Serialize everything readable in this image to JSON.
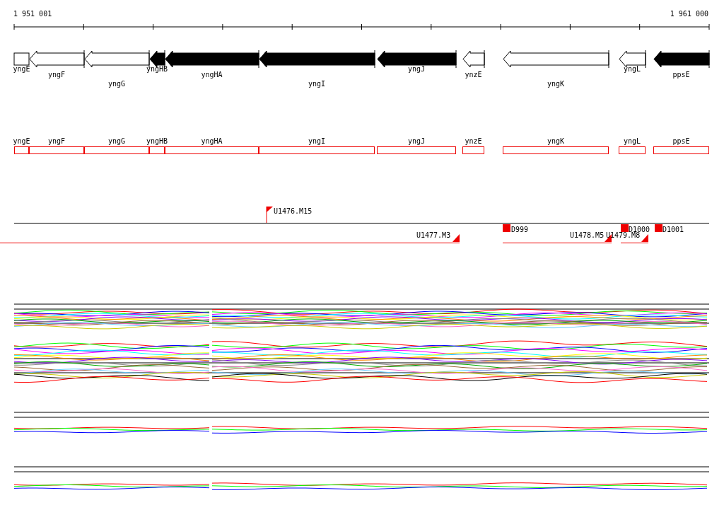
{
  "ruler": {
    "start_label": "1 951 001",
    "end_label": "1 961 000"
  },
  "genes": [
    {
      "name": "yngE",
      "kind": "box",
      "filled": false
    },
    {
      "name": "yngF",
      "kind": "arrow",
      "filled": false
    },
    {
      "name": "yngG",
      "kind": "arrow",
      "filled": false
    },
    {
      "name": "yngHB",
      "kind": "arrow",
      "filled": true
    },
    {
      "name": "yngHA",
      "kind": "arrow",
      "filled": true
    },
    {
      "name": "yngI",
      "kind": "arrow",
      "filled": true
    },
    {
      "name": "yngJ",
      "kind": "arrow",
      "filled": true
    },
    {
      "name": "ynzE",
      "kind": "arrow",
      "filled": false
    },
    {
      "name": "yngK",
      "kind": "arrow",
      "filled": false
    },
    {
      "name": "yngL",
      "kind": "arrow",
      "filled": false
    },
    {
      "name": "ppsE",
      "kind": "arrow",
      "filled": true
    }
  ],
  "gene_boxes": [
    "yngE",
    "yngF",
    "yngG",
    "yngHB",
    "yngHA",
    "yngI",
    "yngJ",
    "ynzE",
    "yngK",
    "yngL",
    "ppsE"
  ],
  "transcription_units": [
    {
      "label": "U1476.M15",
      "kind": "flag"
    },
    {
      "label": "U1477.M3",
      "kind": "triangle"
    },
    {
      "label": "D999",
      "kind": "square"
    },
    {
      "label": "U1478.M5",
      "kind": "triangle"
    },
    {
      "label": "U1479.M8",
      "kind": "triangle"
    },
    {
      "label": "D1000",
      "kind": "square"
    },
    {
      "label": "D1001",
      "kind": "square"
    }
  ]
}
